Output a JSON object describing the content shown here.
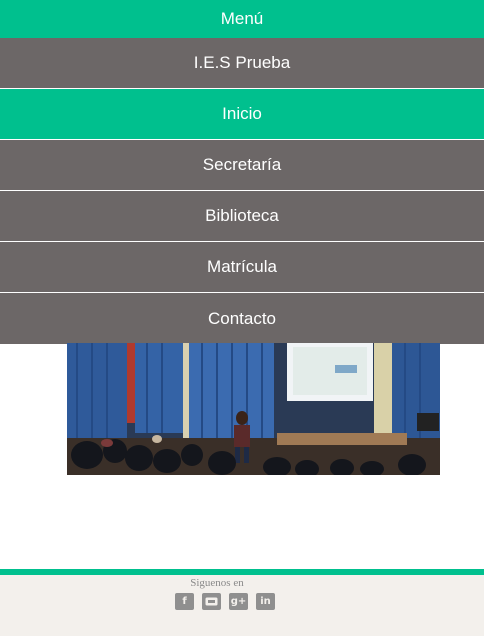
{
  "menu": {
    "title": "Menú"
  },
  "nav": {
    "items": [
      {
        "label": "I.E.S Prueba"
      },
      {
        "label": "Inicio",
        "active": true
      },
      {
        "label": "Secretaría"
      },
      {
        "label": "Biblioteca"
      },
      {
        "label": "Matrícula"
      },
      {
        "label": "Contacto"
      }
    ]
  },
  "footer": {
    "follow_label": "Siguenos en",
    "social": [
      {
        "icon": "facebook-icon",
        "glyph": "f"
      },
      {
        "icon": "tuenti-icon",
        "glyph": ""
      },
      {
        "icon": "googleplus-icon",
        "glyph": "g+"
      },
      {
        "icon": "linkedin-icon",
        "glyph": "in"
      }
    ]
  },
  "colors": {
    "accent": "#00c08e",
    "nav_bg": "#6c6767",
    "footer_bg": "#f3f0ec",
    "social_bg": "#8f8f8f"
  }
}
